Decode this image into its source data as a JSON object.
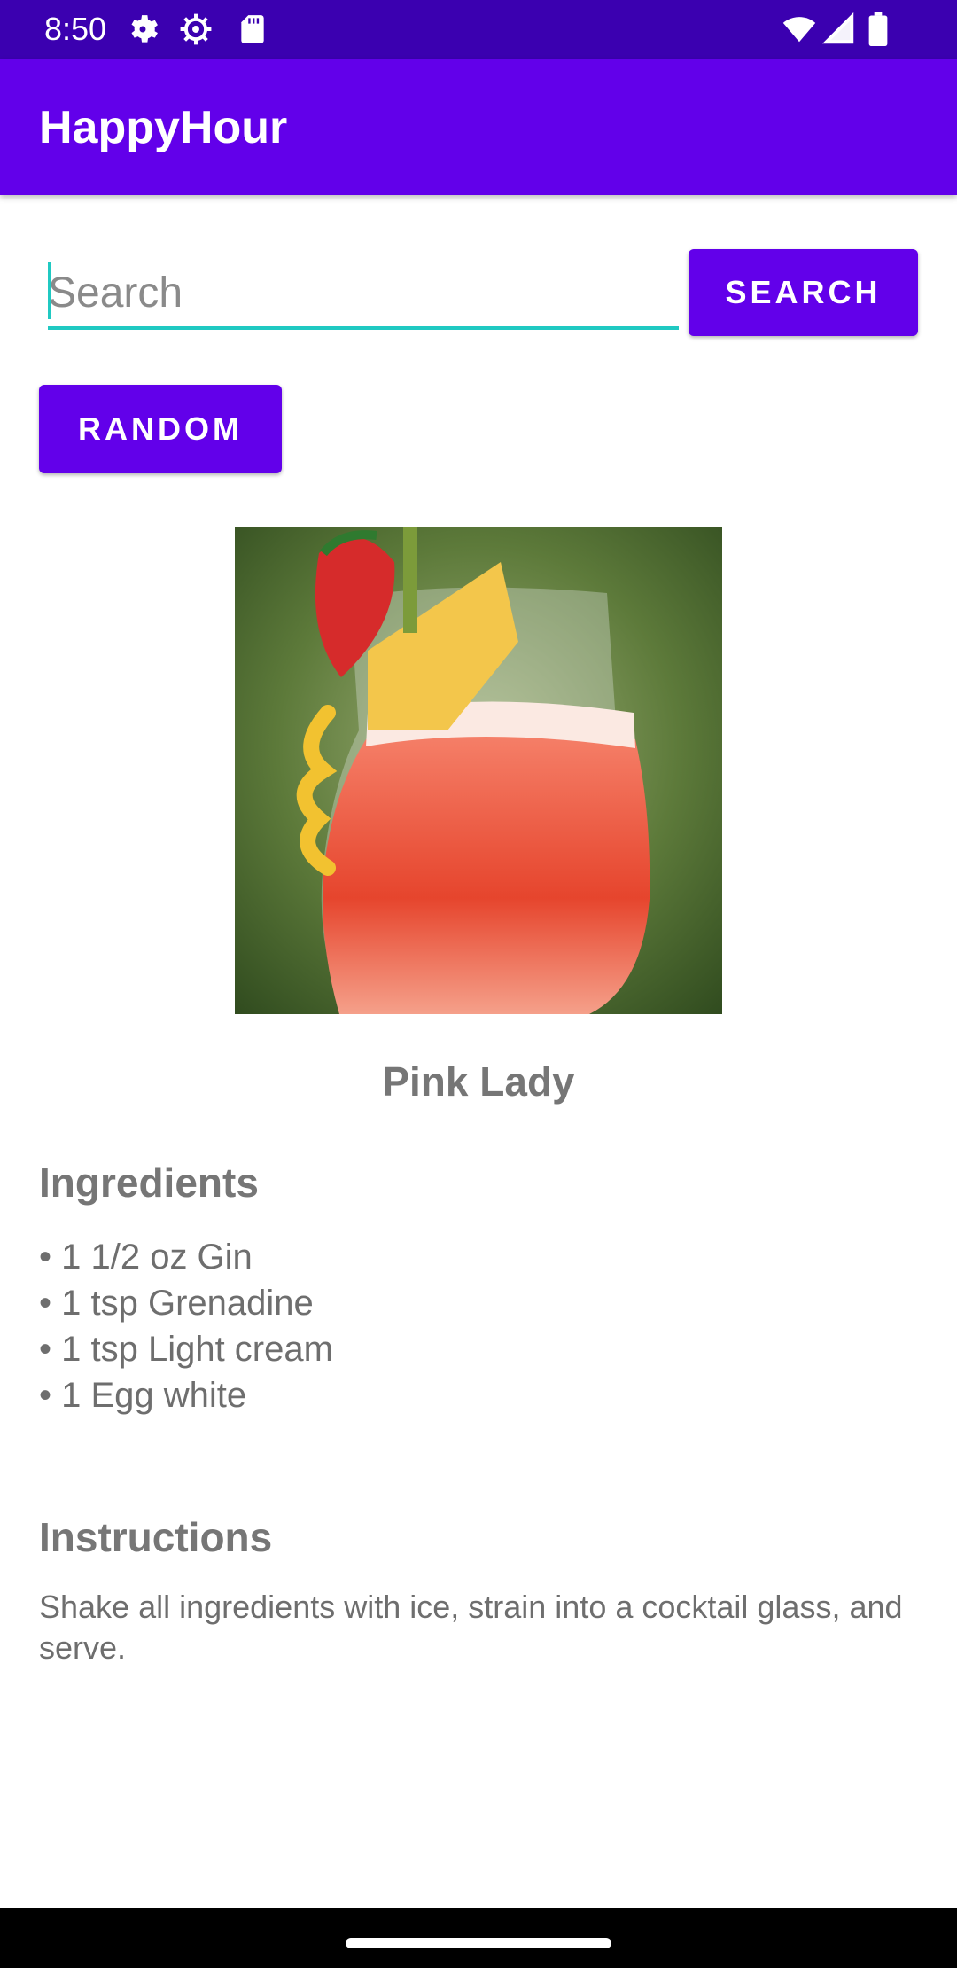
{
  "status_bar": {
    "time": "8:50",
    "icons": [
      "settings-gear-icon",
      "settings-gear-outline-icon",
      "sd-card-icon",
      "wifi-icon",
      "signal-icon",
      "battery-icon"
    ]
  },
  "app_bar": {
    "title": "HappyHour"
  },
  "search": {
    "placeholder": "Search",
    "value": "",
    "button_label": "SEARCH"
  },
  "random_button_label": "RANDOM",
  "drink": {
    "name": "Pink Lady",
    "ingredients_title": "Ingredients",
    "ingredients": [
      "• 1 1/2 oz Gin",
      "• 1 tsp Grenadine",
      "• 1 tsp Light cream",
      "• 1 Egg white"
    ],
    "instructions_title": "Instructions",
    "instructions": "Shake all ingredients with ice, strain into a cocktail glass, and serve."
  },
  "colors": {
    "primary": "#6200ea",
    "status_bar": "#3b00b0",
    "accent": "#20c9c2",
    "text_gray": "#767676"
  }
}
